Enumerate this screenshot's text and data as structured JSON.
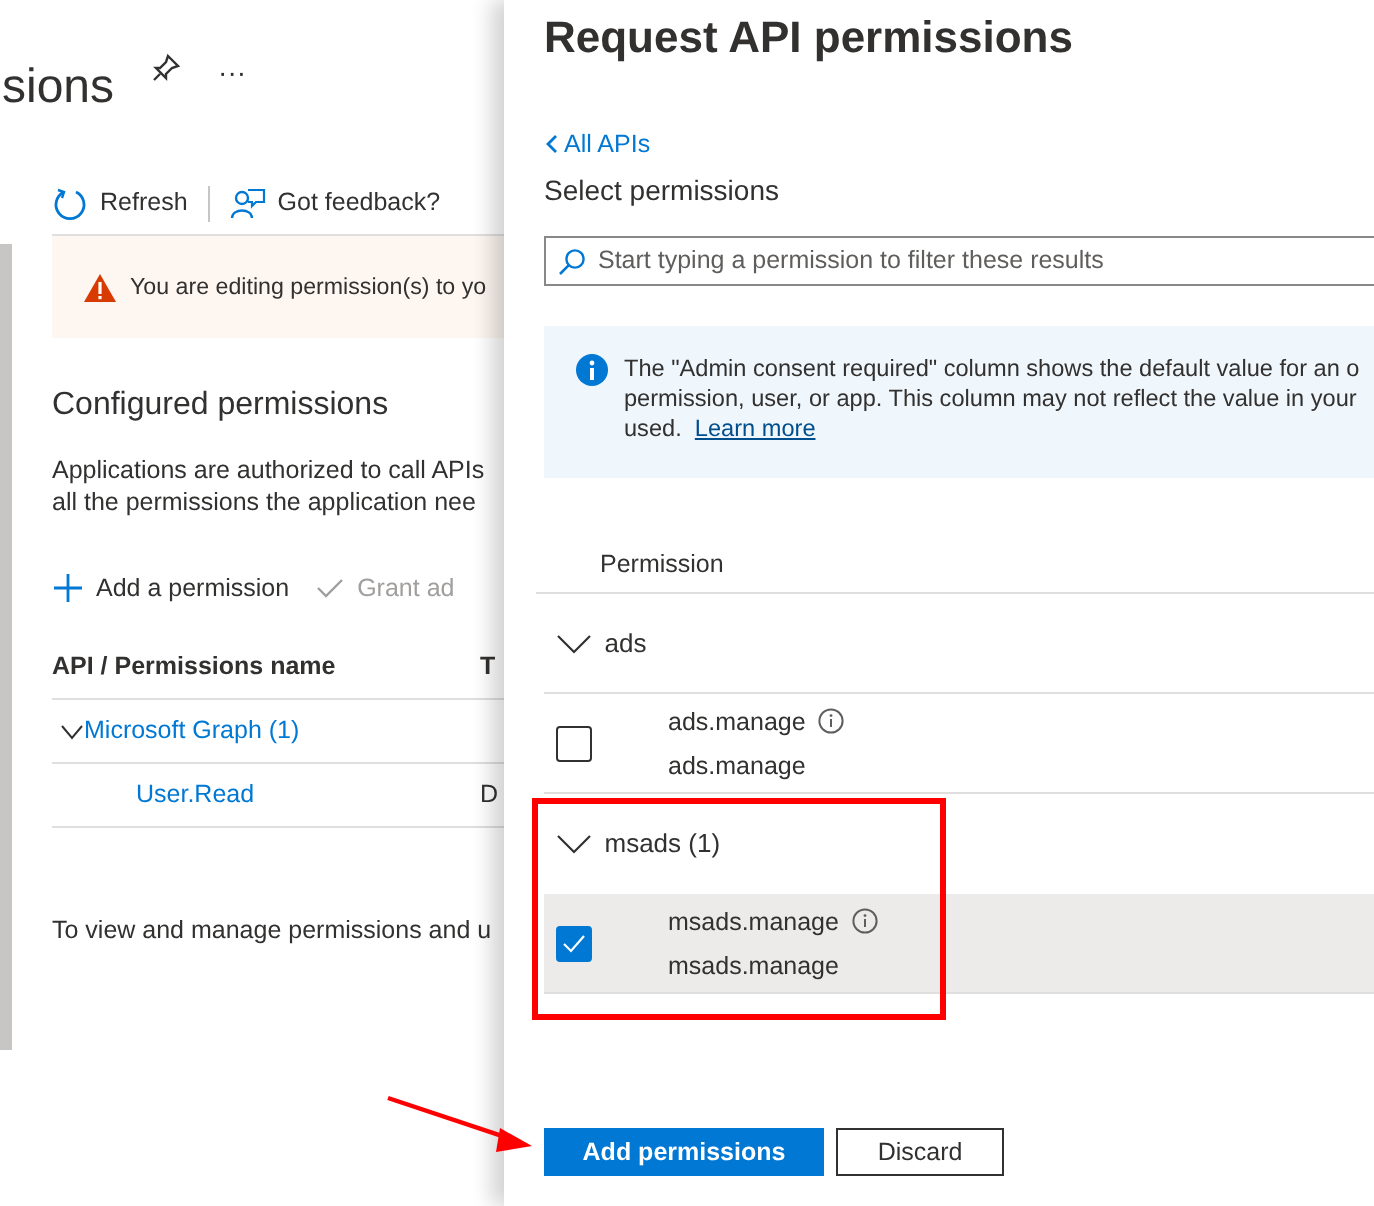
{
  "page": {
    "title": "sions",
    "more": "···",
    "toolbar": [
      "Refresh",
      "Got feedback?"
    ],
    "warning": "You are editing permission(s) to yo",
    "section_title": "Configured permissions",
    "description": [
      "Applications are authorized to call APIs",
      "all the permissions the application nee"
    ],
    "actions": [
      {
        "label": "Add a permission",
        "kind": "add"
      },
      {
        "label": "Grant ad",
        "kind": "grant"
      }
    ],
    "table": {
      "columns": [
        "API / Permissions name",
        "T"
      ],
      "rows": [
        {
          "kind": "group",
          "cells": [
            "Microsoft Graph (1)",
            ""
          ],
          "expanded": true
        },
        {
          "kind": "item",
          "cells": [
            "User.Read",
            "D"
          ]
        }
      ]
    },
    "footer": "To view and manage permissions and u"
  },
  "panel": {
    "title": "Request API permissions",
    "back_link": "All APIs",
    "subtitle": "Select permissions",
    "search": {
      "placeholder": "Start typing a permission to filter these results"
    },
    "info": {
      "lines": [
        "The \"Admin consent required\" column shows the default value for an o",
        "permission, user, or app. This column may not reflect the value in your",
        "used."
      ],
      "link": "Learn more"
    },
    "column": "Permission",
    "groups": [
      {
        "name": "ads",
        "expanded": true,
        "items": [
          {
            "name": "ads.manage",
            "description": "ads.manage",
            "checked": false,
            "selected": false
          }
        ]
      },
      {
        "name": "msads (1)",
        "expanded": true,
        "items": [
          {
            "name": "msads.manage",
            "description": "msads.manage",
            "checked": true,
            "selected": true
          }
        ]
      }
    ],
    "buttons": [
      {
        "label": "Add permissions",
        "kind": "primary"
      },
      {
        "label": "Discard",
        "kind": "secondary"
      }
    ]
  },
  "annotations": [
    {
      "kind": "highlight-box"
    },
    {
      "kind": "arrow"
    }
  ]
}
